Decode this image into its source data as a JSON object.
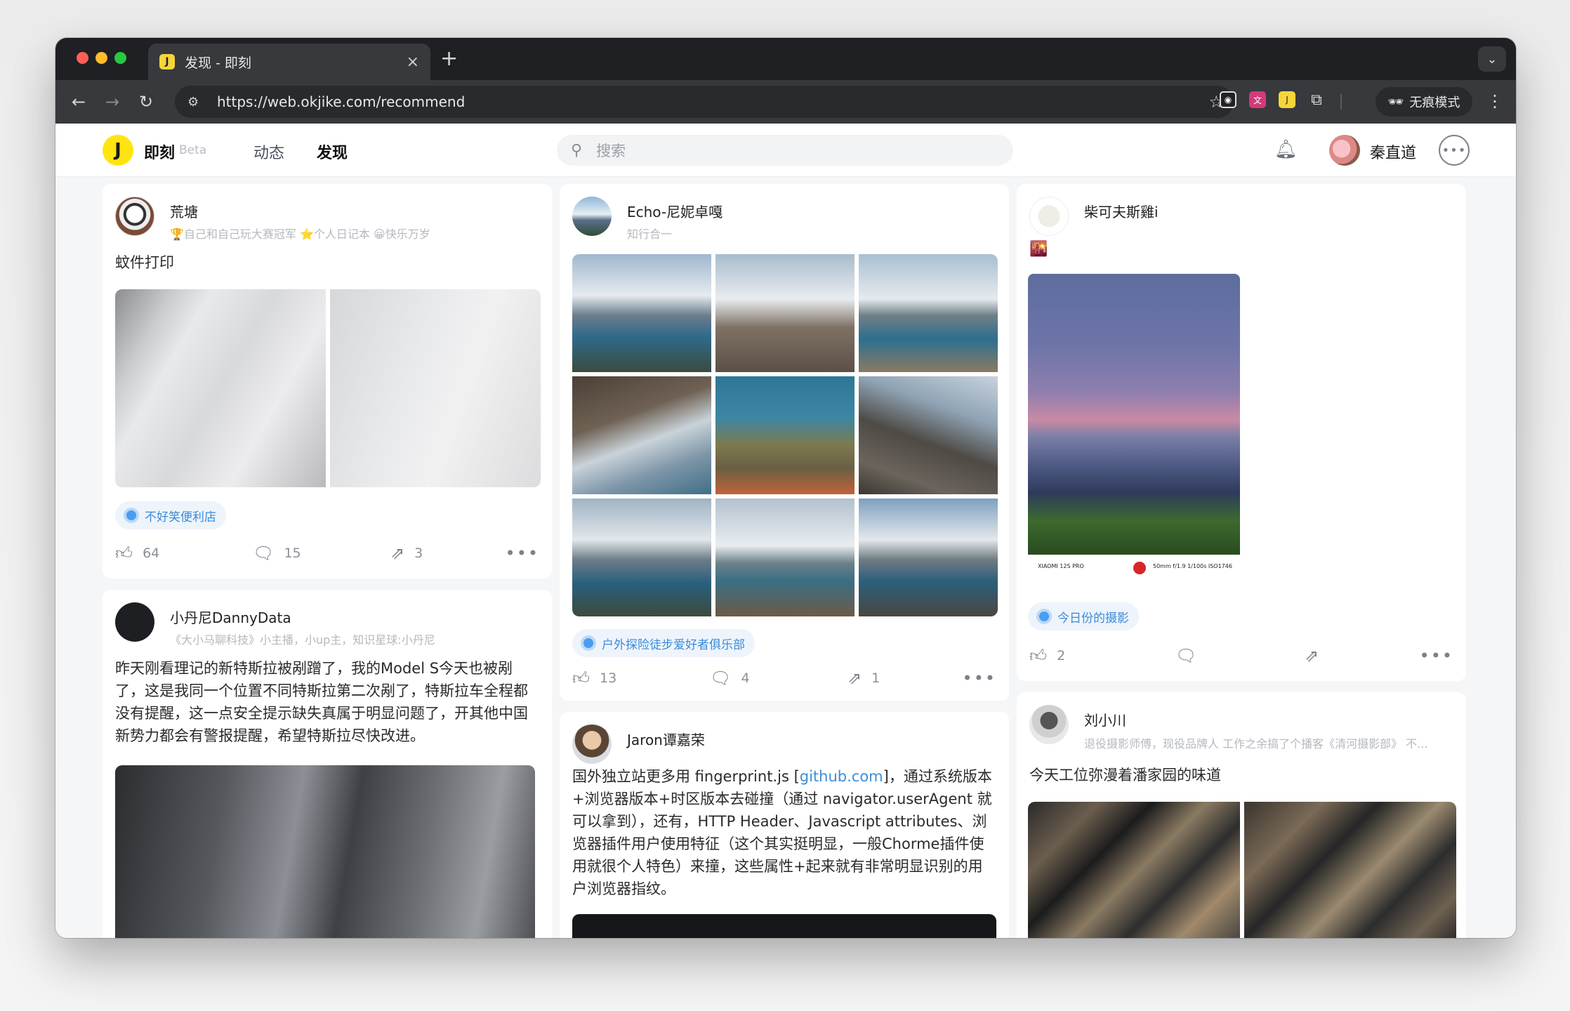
{
  "browser": {
    "tab_title": "发现 - 即刻",
    "tab_close": "×",
    "new_tab": "+",
    "url": "https://web.okjike.com/recommend",
    "incognito_label": "无痕模式"
  },
  "site": {
    "brand": "即刻",
    "beta": "Beta",
    "nav_feed": "动态",
    "nav_discover": "发现",
    "search_placeholder": "搜索",
    "user_name": "秦直道"
  },
  "posts": [
    {
      "user": "荒塘",
      "bio": "🏆自己和自己玩大赛冠军 ⭐个人日记本 😀快乐万岁",
      "text": "蚊件打印",
      "topic": "不好笑便利店",
      "likes": "64",
      "comments": "15",
      "shares": "3"
    },
    {
      "user": "小丹尼DannyData",
      "bio": "《大小马聊科技》小主播，小up主，知识星球:小丹尼",
      "text": "昨天刚看理记的新特斯拉被剐蹭了，我的Model S今天也被剐了，这是我同一个位置不同特斯拉第二次剐了，特斯拉车全程都没有提醒，这一点安全提示缺失真属于明显问题了，开其他中国新势力都会有警报提醒，希望特斯拉尽快改进。"
    },
    {
      "user": "Echo-尼妮卓嘎",
      "bio": "知行合一",
      "topic": "户外探险徒步爱好者俱乐部",
      "likes": "13",
      "comments": "4",
      "shares": "1"
    },
    {
      "user": "Jaron谭嘉荣",
      "text_before": "国外独立站更多用 fingerprint.js [",
      "text_link": "github.com",
      "text_after": "]，通过系统版本+浏览器版本+时区版本去碰撞（通过 navigator.userAgent 就可以拿到），还有，HTTP Header、Javascript attributes、浏览器插件用户使用特征（这个其实挺明显，一般Chorme插件使用就很个人特色）来撞，这些属性+起来就有非常明显识别的用户浏览器指纹。"
    },
    {
      "user": "柴可夫斯雞i",
      "text": "🌇",
      "photo_caption_model": "XIAOMI 12S PRO",
      "photo_caption_params": "50mm f/1.9 1/100s ISO1746",
      "topic": "今日份的摄影",
      "likes": "2"
    },
    {
      "user": "刘小川",
      "bio": "退役摄影师傅，现役品牌人 工作之余搞了个播客《清河摄影部》 不...",
      "text": "今天工位弥漫着潘家园的味道"
    }
  ],
  "colors": {
    "accent_yellow": "#ffe411",
    "link_blue": "#3b8fd9",
    "topic_bg": "#eef4fb"
  }
}
